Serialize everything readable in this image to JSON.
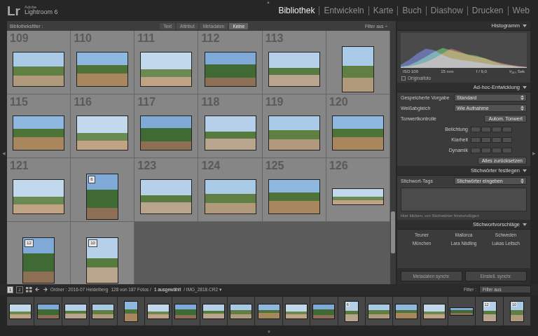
{
  "app": {
    "logo": "Lr",
    "vendor": "Adobe",
    "name": "Lightroom 6"
  },
  "arrows": {
    "top": "▲",
    "bottom": "▼",
    "left": "◀",
    "right": "▶"
  },
  "modules": [
    {
      "label": "Bibliothek",
      "selected": true
    },
    {
      "label": "Entwickeln",
      "selected": false
    },
    {
      "label": "Karte",
      "selected": false
    },
    {
      "label": "Buch",
      "selected": false
    },
    {
      "label": "Diashow",
      "selected": false
    },
    {
      "label": "Drucken",
      "selected": false
    },
    {
      "label": "Web",
      "selected": false
    }
  ],
  "filter_bar": {
    "title": "Bibliotheksfilter :",
    "options": [
      {
        "label": "Text",
        "selected": false
      },
      {
        "label": "Attribut",
        "selected": false
      },
      {
        "label": "Metadaten",
        "selected": false
      },
      {
        "label": "Keine",
        "selected": true
      }
    ],
    "status": "Filter aus ÷"
  },
  "grid": {
    "cells": [
      {
        "number": "109",
        "kind": "landscape"
      },
      {
        "number": "110",
        "kind": "landscape"
      },
      {
        "number": "111",
        "kind": "landscape"
      },
      {
        "number": "112",
        "kind": "landscape"
      },
      {
        "number": "113",
        "kind": "landscape"
      },
      {
        "kind": "portrait"
      },
      {
        "number": "115",
        "kind": "landscape"
      },
      {
        "number": "116",
        "kind": "landscape"
      },
      {
        "number": "117",
        "kind": "landscape"
      },
      {
        "number": "118",
        "kind": "landscape"
      },
      {
        "number": "119",
        "kind": "landscape"
      },
      {
        "number": "120",
        "kind": "landscape"
      },
      {
        "number": "121",
        "kind": "landscape"
      },
      {
        "kind": "portrait",
        "badge": "6"
      },
      {
        "number": "123",
        "kind": "landscape"
      },
      {
        "number": "124",
        "kind": "landscape"
      },
      {
        "number": "125",
        "kind": "landscape"
      },
      {
        "number": "126",
        "kind": "panorama"
      },
      {
        "kind": "portrait",
        "badge": "12"
      },
      {
        "kind": "portrait",
        "badge": "10"
      }
    ],
    "scrollbar": {
      "level": 0.86
    }
  },
  "histogram": {
    "title": "Histogramm",
    "series": [
      {
        "color": "#d23c3c",
        "values": [
          2,
          5,
          10,
          18,
          30,
          45,
          60,
          52,
          40,
          35,
          30,
          22,
          15,
          10,
          6,
          3
        ]
      },
      {
        "color": "#3cbf3c",
        "values": [
          3,
          8,
          20,
          35,
          50,
          62,
          55,
          48,
          42,
          38,
          30,
          20,
          12,
          8,
          4,
          2
        ]
      },
      {
        "color": "#4a5ee0",
        "values": [
          10,
          25,
          45,
          60,
          55,
          40,
          30,
          25,
          22,
          18,
          14,
          10,
          8,
          6,
          4,
          2
        ]
      }
    ],
    "info": [
      "ISO 100",
      "15 mm",
      "f / 9,0",
      "¹⁄₁₆₀ Sek"
    ],
    "original": {
      "label": "Originalfoto",
      "checked": false
    }
  },
  "quick_develop": {
    "title": "Ad-hoc-Entwicklung",
    "rows": [
      {
        "kind": "dropdown",
        "label": "Gespeicherte Vorgabe",
        "value": "Standard"
      },
      {
        "kind": "dropdown",
        "label": "Weißabgleich",
        "value": "Wie Aufnahme"
      },
      {
        "kind": "button",
        "label": "Tonwertkontrolle",
        "value": "Autom. Tonwert"
      },
      {
        "kind": "stepper",
        "label": "Belichtung"
      },
      {
        "kind": "stepper",
        "label": "Klarheit"
      },
      {
        "kind": "stepper",
        "label": "Dynamik"
      },
      {
        "kind": "reset",
        "value": "Alles zurücksetzen"
      }
    ]
  },
  "keywording": {
    "title": "Stichwörter festlegen",
    "tags_label": "Stichwort-Tags",
    "tags_value": "Stichwörter eingeben",
    "hint": "Hier klicken, um Stichwörter hinzuzufügen",
    "suggestions_title": "Stichwortvorschläge",
    "suggestions": [
      "Teuner",
      "Mallorca",
      "Schweden",
      "München",
      "Lara Nädling",
      "Lukas Leitsch"
    ]
  },
  "sync_buttons": [
    "Metadaten synchr.",
    "Einstell. synchr."
  ],
  "toolbar": {
    "views": [
      {
        "label": "1",
        "selected": true
      },
      {
        "label": "2",
        "selected": false
      }
    ],
    "folder": "Ordner : 2016-07 Heidelberg",
    "count": "128 von 187 Fotos /",
    "selected": "1 ausgewählt",
    "file": "/ IMG_2818.CR2 ▾",
    "filter_label": "Filter :",
    "filter_value": "Filter aus"
  },
  "filmstrip": {
    "thumbs": [
      {
        "kind": "landscape"
      },
      {
        "kind": "landscape"
      },
      {
        "kind": "landscape"
      },
      {
        "kind": "landscape"
      },
      {
        "kind": "portrait"
      },
      {
        "kind": "landscape"
      },
      {
        "kind": "landscape"
      },
      {
        "kind": "landscape"
      },
      {
        "kind": "landscape"
      },
      {
        "kind": "landscape"
      },
      {
        "kind": "landscape"
      },
      {
        "kind": "landscape"
      },
      {
        "kind": "portrait",
        "badge": "6"
      },
      {
        "kind": "landscape"
      },
      {
        "kind": "landscape"
      },
      {
        "kind": "landscape"
      },
      {
        "kind": "panorama"
      },
      {
        "kind": "portrait",
        "badge": "12"
      },
      {
        "kind": "portrait",
        "badge": "10"
      }
    ]
  }
}
